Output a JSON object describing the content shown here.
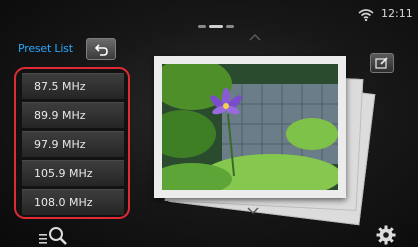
{
  "status": {
    "time": "12:11",
    "wifi_icon": "wifi-icon"
  },
  "preset_panel": {
    "title": "Preset List",
    "back_icon": "back-arrow-icon",
    "items": [
      {
        "label": "87.5  MHz"
      },
      {
        "label": "89.9  MHz"
      },
      {
        "label": "97.9  MHz"
      },
      {
        "label": "105.9  MHz"
      },
      {
        "label": "108.0  MHz"
      }
    ],
    "highlight_color": "#e02b35"
  },
  "right_controls": {
    "edit_icon": "edit-icon",
    "settings_icon": "settings-gear-icon"
  },
  "bottom_controls": {
    "search_icon": "search-list-icon"
  },
  "colors": {
    "accent": "#2aa6ff",
    "background": "#111111"
  }
}
